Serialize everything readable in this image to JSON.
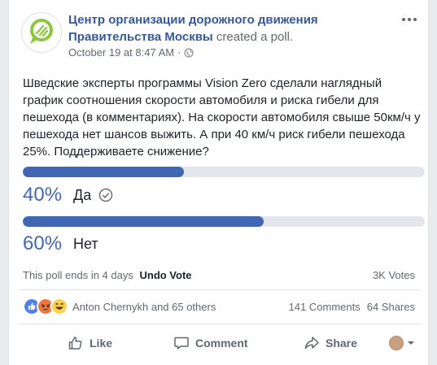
{
  "post": {
    "page_name_line1": "Центр организации дорожного движения",
    "page_name_line2": "Правительства Москвы",
    "action_text": "created a poll.",
    "timestamp": "October 19 at 8:47 AM",
    "meta_separator": "·",
    "audience_icon": "globe-icon",
    "text": "Шведские эксперты программы Vision Zero сделали наглядный график соотношения скорости автомобиля и риска гибели для пешехода (в комментариях). На скорости автомобиля свыше 50км/ч у пешехода нет шансов выжить. А при 40 км/ч риск гибели пешехода 25%. Поддерживаете снижение?"
  },
  "poll": {
    "options": [
      {
        "percent_label": "40%",
        "label": "Да",
        "share": 0.4,
        "voted": true
      },
      {
        "percent_label": "60%",
        "label": "Нет",
        "share": 0.6,
        "voted": false
      }
    ],
    "ends_text": "This poll ends in 4 days",
    "undo_label": "Undo Vote",
    "votes_text": "3K Votes",
    "bar_color": "#4267b2"
  },
  "engagement": {
    "reaction_icons": [
      "like-reaction-icon",
      "angry-reaction-icon",
      "haha-reaction-icon"
    ],
    "reactors_text": "Anton Chernykh and 65 others",
    "comments_text": "141 Comments",
    "shares_text": "64 Shares"
  },
  "actions": {
    "like_label": "Like",
    "comment_label": "Comment",
    "share_label": "Share"
  },
  "colors": {
    "link": "#365899",
    "accent": "#4267b2",
    "logo_green": "#8dc63f"
  }
}
